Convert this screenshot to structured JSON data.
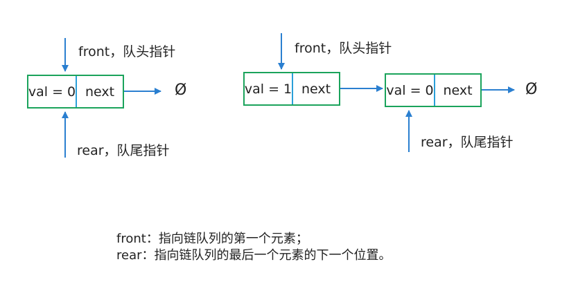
{
  "colors": {
    "node_border": "#1aa35b",
    "divider": "#2a9fd8",
    "arrow": "#2a7fd0"
  },
  "diagram_left": {
    "front_label": "front，队头指针",
    "rear_label": "rear，队尾指针",
    "node": {
      "val": "val = 0",
      "next": "next"
    },
    "null_symbol": "Ø"
  },
  "diagram_right": {
    "front_label": "front，队头指针",
    "rear_label": "rear，队尾指针",
    "node1": {
      "val": "val = 1",
      "next": "next"
    },
    "node2": {
      "val": "val = 0",
      "next": "next"
    },
    "null_symbol": "Ø"
  },
  "notes": {
    "line1": "front：指向链队列的第一个元素；",
    "line2": "rear：指向链队列的最后一个元素的下一个位置。"
  }
}
